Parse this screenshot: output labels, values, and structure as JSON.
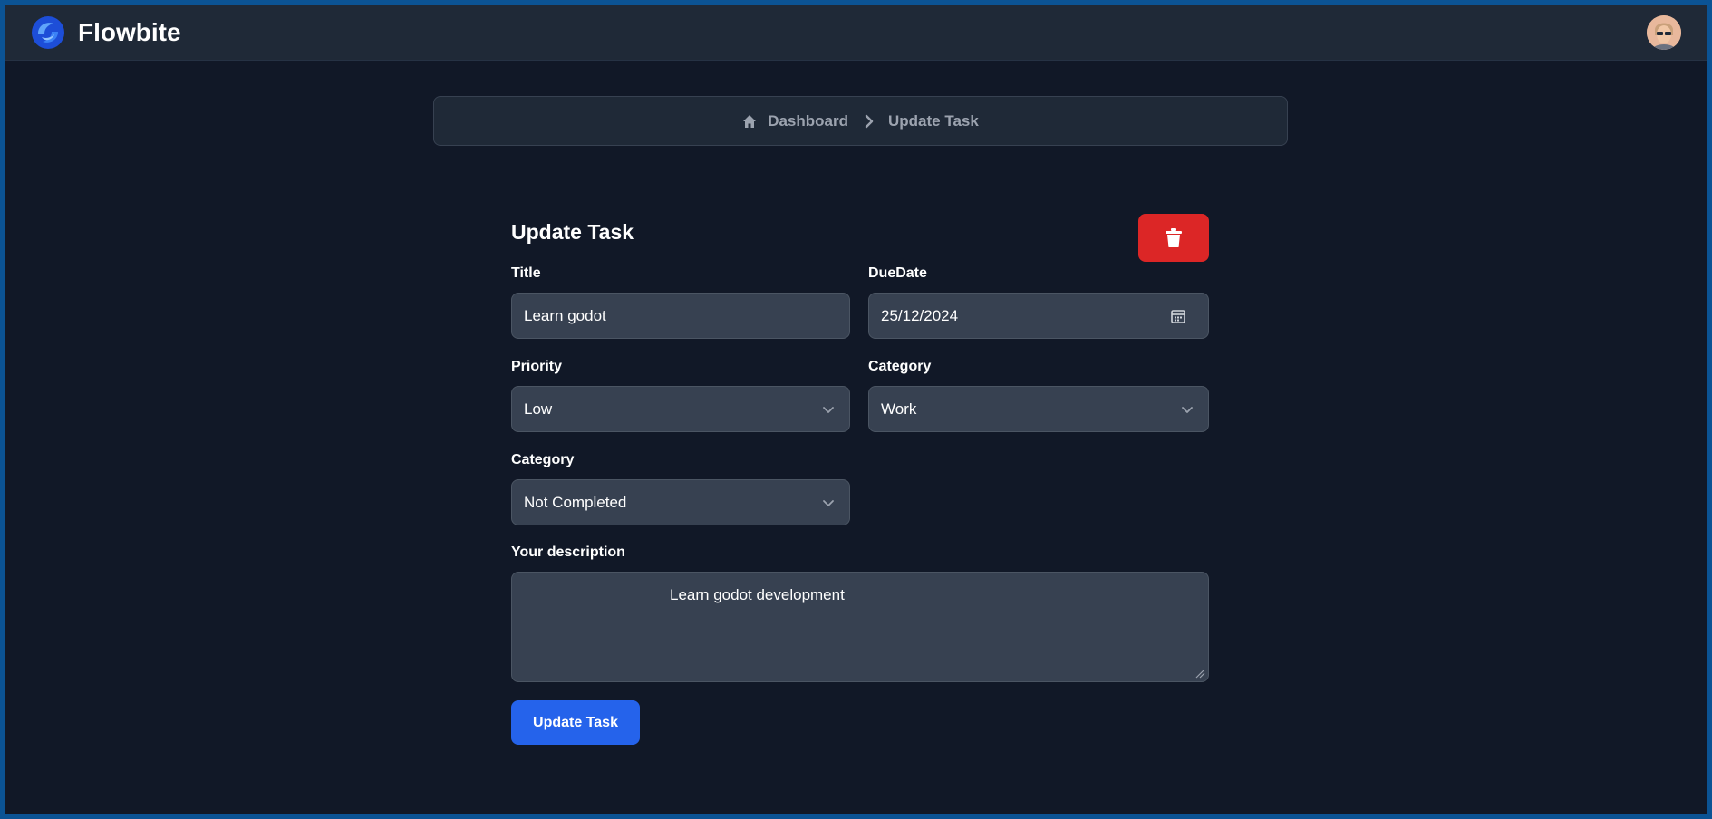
{
  "app": {
    "brand_name": "Flowbite",
    "brand_logo_icon": "flowbite-logo-icon",
    "avatar_icon": "user-avatar-icon"
  },
  "breadcrumb": {
    "home_icon": "home-icon",
    "home_label": "Dashboard",
    "separator_icon": "chevron-right-icon",
    "current_label": "Update Task"
  },
  "form": {
    "heading": "Update Task",
    "delete_icon": "trash-icon",
    "delete_color": "#dc2626",
    "title_label": "Title",
    "title_value": "Learn godot",
    "due_label": "DueDate",
    "due_value": "25/12/2024",
    "due_icon": "calendar-icon",
    "priority_label": "Priority",
    "priority_value": "Low",
    "category_label": "Category",
    "category_value": "Work",
    "status_label": "Category",
    "status_value": "Not Completed",
    "description_label": "Your description",
    "description_value": "Learn godot development",
    "submit_label": "Update Task",
    "submit_color": "#2563eb"
  }
}
